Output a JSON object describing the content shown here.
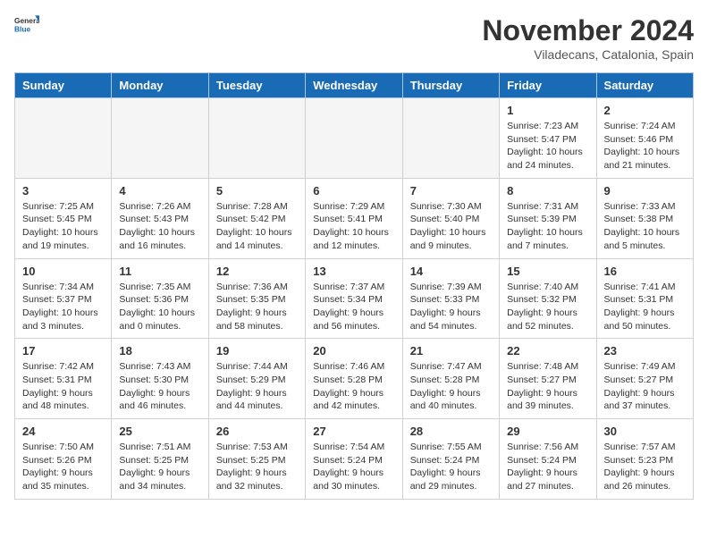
{
  "header": {
    "logo_general": "General",
    "logo_blue": "Blue",
    "month_year": "November 2024",
    "location": "Viladecans, Catalonia, Spain"
  },
  "days_of_week": [
    "Sunday",
    "Monday",
    "Tuesday",
    "Wednesday",
    "Thursday",
    "Friday",
    "Saturday"
  ],
  "weeks": [
    [
      {
        "day": "",
        "detail": ""
      },
      {
        "day": "",
        "detail": ""
      },
      {
        "day": "",
        "detail": ""
      },
      {
        "day": "",
        "detail": ""
      },
      {
        "day": "",
        "detail": ""
      },
      {
        "day": "1",
        "detail": "Sunrise: 7:23 AM\nSunset: 5:47 PM\nDaylight: 10 hours\nand 24 minutes."
      },
      {
        "day": "2",
        "detail": "Sunrise: 7:24 AM\nSunset: 5:46 PM\nDaylight: 10 hours\nand 21 minutes."
      }
    ],
    [
      {
        "day": "3",
        "detail": "Sunrise: 7:25 AM\nSunset: 5:45 PM\nDaylight: 10 hours\nand 19 minutes."
      },
      {
        "day": "4",
        "detail": "Sunrise: 7:26 AM\nSunset: 5:43 PM\nDaylight: 10 hours\nand 16 minutes."
      },
      {
        "day": "5",
        "detail": "Sunrise: 7:28 AM\nSunset: 5:42 PM\nDaylight: 10 hours\nand 14 minutes."
      },
      {
        "day": "6",
        "detail": "Sunrise: 7:29 AM\nSunset: 5:41 PM\nDaylight: 10 hours\nand 12 minutes."
      },
      {
        "day": "7",
        "detail": "Sunrise: 7:30 AM\nSunset: 5:40 PM\nDaylight: 10 hours\nand 9 minutes."
      },
      {
        "day": "8",
        "detail": "Sunrise: 7:31 AM\nSunset: 5:39 PM\nDaylight: 10 hours\nand 7 minutes."
      },
      {
        "day": "9",
        "detail": "Sunrise: 7:33 AM\nSunset: 5:38 PM\nDaylight: 10 hours\nand 5 minutes."
      }
    ],
    [
      {
        "day": "10",
        "detail": "Sunrise: 7:34 AM\nSunset: 5:37 PM\nDaylight: 10 hours\nand 3 minutes."
      },
      {
        "day": "11",
        "detail": "Sunrise: 7:35 AM\nSunset: 5:36 PM\nDaylight: 10 hours\nand 0 minutes."
      },
      {
        "day": "12",
        "detail": "Sunrise: 7:36 AM\nSunset: 5:35 PM\nDaylight: 9 hours\nand 58 minutes."
      },
      {
        "day": "13",
        "detail": "Sunrise: 7:37 AM\nSunset: 5:34 PM\nDaylight: 9 hours\nand 56 minutes."
      },
      {
        "day": "14",
        "detail": "Sunrise: 7:39 AM\nSunset: 5:33 PM\nDaylight: 9 hours\nand 54 minutes."
      },
      {
        "day": "15",
        "detail": "Sunrise: 7:40 AM\nSunset: 5:32 PM\nDaylight: 9 hours\nand 52 minutes."
      },
      {
        "day": "16",
        "detail": "Sunrise: 7:41 AM\nSunset: 5:31 PM\nDaylight: 9 hours\nand 50 minutes."
      }
    ],
    [
      {
        "day": "17",
        "detail": "Sunrise: 7:42 AM\nSunset: 5:31 PM\nDaylight: 9 hours\nand 48 minutes."
      },
      {
        "day": "18",
        "detail": "Sunrise: 7:43 AM\nSunset: 5:30 PM\nDaylight: 9 hours\nand 46 minutes."
      },
      {
        "day": "19",
        "detail": "Sunrise: 7:44 AM\nSunset: 5:29 PM\nDaylight: 9 hours\nand 44 minutes."
      },
      {
        "day": "20",
        "detail": "Sunrise: 7:46 AM\nSunset: 5:28 PM\nDaylight: 9 hours\nand 42 minutes."
      },
      {
        "day": "21",
        "detail": "Sunrise: 7:47 AM\nSunset: 5:28 PM\nDaylight: 9 hours\nand 40 minutes."
      },
      {
        "day": "22",
        "detail": "Sunrise: 7:48 AM\nSunset: 5:27 PM\nDaylight: 9 hours\nand 39 minutes."
      },
      {
        "day": "23",
        "detail": "Sunrise: 7:49 AM\nSunset: 5:27 PM\nDaylight: 9 hours\nand 37 minutes."
      }
    ],
    [
      {
        "day": "24",
        "detail": "Sunrise: 7:50 AM\nSunset: 5:26 PM\nDaylight: 9 hours\nand 35 minutes."
      },
      {
        "day": "25",
        "detail": "Sunrise: 7:51 AM\nSunset: 5:25 PM\nDaylight: 9 hours\nand 34 minutes."
      },
      {
        "day": "26",
        "detail": "Sunrise: 7:53 AM\nSunset: 5:25 PM\nDaylight: 9 hours\nand 32 minutes."
      },
      {
        "day": "27",
        "detail": "Sunrise: 7:54 AM\nSunset: 5:24 PM\nDaylight: 9 hours\nand 30 minutes."
      },
      {
        "day": "28",
        "detail": "Sunrise: 7:55 AM\nSunset: 5:24 PM\nDaylight: 9 hours\nand 29 minutes."
      },
      {
        "day": "29",
        "detail": "Sunrise: 7:56 AM\nSunset: 5:24 PM\nDaylight: 9 hours\nand 27 minutes."
      },
      {
        "day": "30",
        "detail": "Sunrise: 7:57 AM\nSunset: 5:23 PM\nDaylight: 9 hours\nand 26 minutes."
      }
    ]
  ]
}
